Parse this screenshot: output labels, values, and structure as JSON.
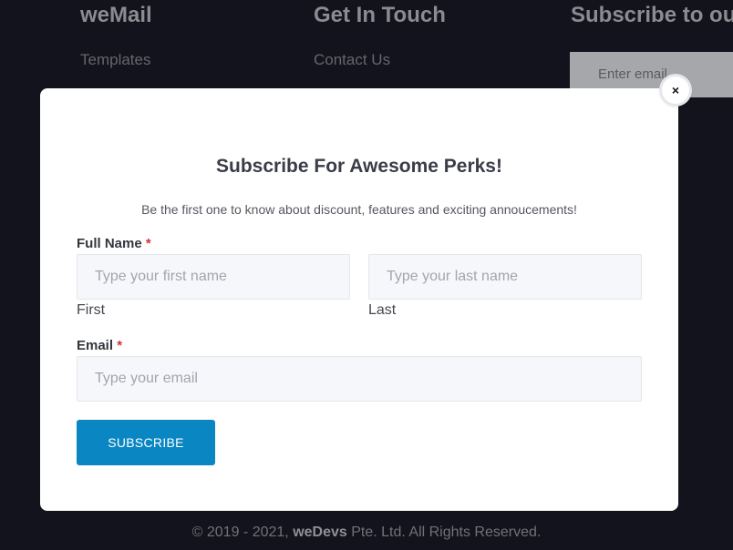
{
  "footer": {
    "col1": {
      "title": "weMail",
      "link": "Templates"
    },
    "col2": {
      "title": "Get In Touch",
      "link": "Contact Us"
    },
    "col3": {
      "title": "Subscribe to ou",
      "email_placeholder": "Enter email"
    },
    "copyright_prefix": "© 2019 - 2021,",
    "copyright_brand": "weDevs",
    "copyright_suffix": "Pte. Ltd. All Rights Reserved."
  },
  "modal": {
    "close_label": "×",
    "title": "Subscribe For Awesome Perks!",
    "subtitle": "Be the first one to know about discount, features and exciting annoucements!",
    "full_name_label": "Full Name",
    "required_mark": "*",
    "first_placeholder": "Type your first name",
    "last_placeholder": "Type your last name",
    "first_sublabel": "First",
    "last_sublabel": "Last",
    "email_label": "Email",
    "email_placeholder": "Type your email",
    "submit_label": "SUBSCRIBE"
  }
}
